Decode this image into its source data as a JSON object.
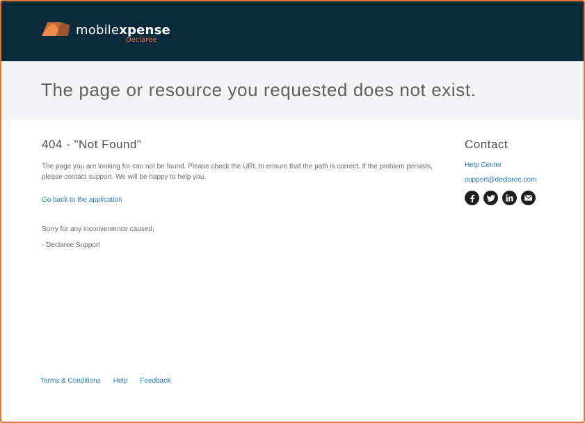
{
  "header": {
    "logo_icon": "mobilexpense-logo-icon",
    "logo_text_light": "mobile",
    "logo_text_bold": "xpense",
    "logo_sub": "Declaree",
    "brand_color": "#0a2b3b",
    "accent_color": "#e8733a"
  },
  "banner": {
    "title": "The page or resource you requested does not exist."
  },
  "main": {
    "heading": "404 - \"Not Found\"",
    "description": "The page you are looking for can not be found. Please check the URL to ensure that the path is correct. If the problem persists, please contact support. We will be happy to help you.",
    "back_link": "Go back to the application",
    "sorry": "Sorry for any inconvenience caused,",
    "signature": "- Declaree Support"
  },
  "contact": {
    "heading": "Contact",
    "help_center": "Help Center",
    "email": "support@declaree.com",
    "socials": [
      {
        "icon": "facebook-icon"
      },
      {
        "icon": "twitter-icon"
      },
      {
        "icon": "linkedin-icon"
      },
      {
        "icon": "email-icon"
      }
    ]
  },
  "footer": {
    "links": [
      "Terms & Conditions",
      "Help",
      "Feedback"
    ]
  }
}
